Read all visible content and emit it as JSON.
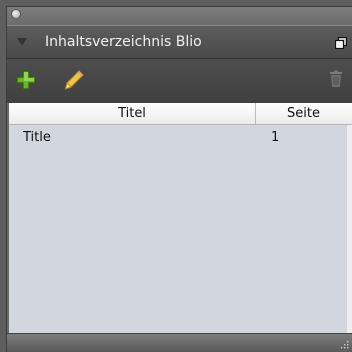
{
  "panel": {
    "title": "Inhaltsverzeichnis Blio"
  },
  "table": {
    "columns": [
      "Titel",
      "Seite"
    ],
    "rows": [
      {
        "title": "Title",
        "page": "1"
      }
    ]
  },
  "icons": {
    "collapse": "disclosure-triangle-icon",
    "panel_menu": "panel-menu-icon",
    "add": "plus-icon",
    "edit": "pencil-icon",
    "delete": "trash-icon",
    "resize": "resize-grip-icon"
  },
  "colors": {
    "add_green": "#6ab32a",
    "pencil_yellow": "#f1c44a",
    "table_bg": "#d2d7df",
    "title_bar": "#4f4f4f"
  }
}
